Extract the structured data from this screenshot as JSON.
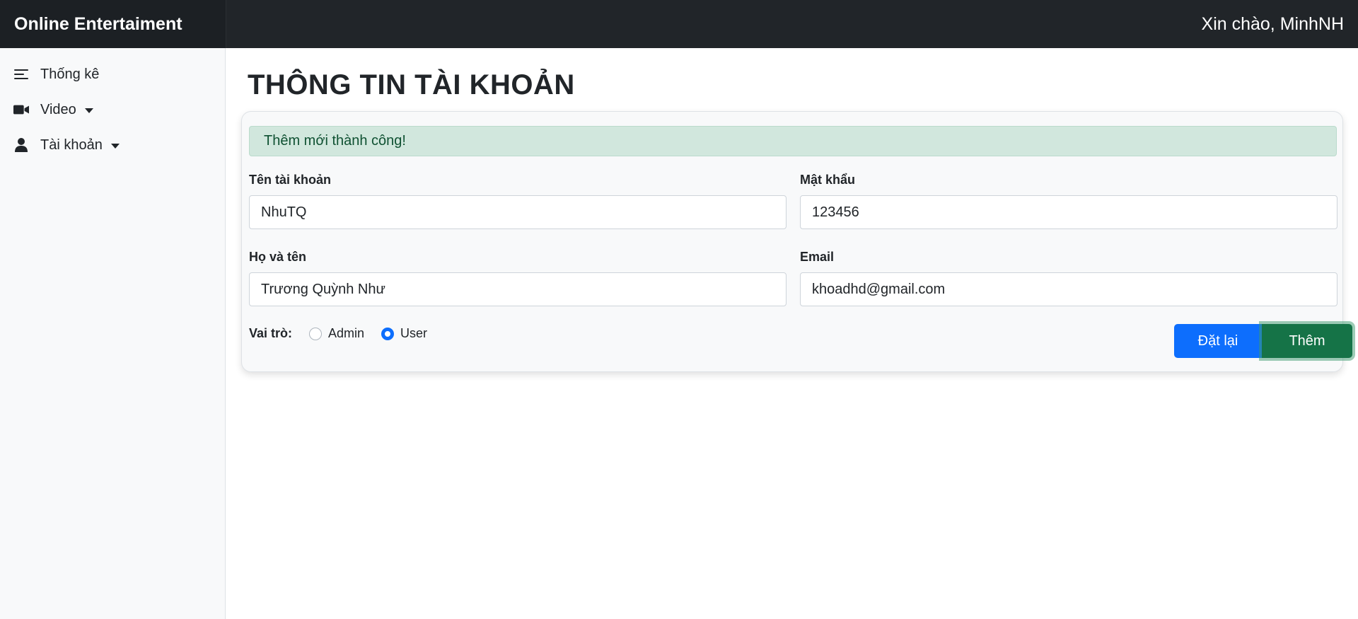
{
  "header": {
    "brand": "Online Entertaiment",
    "greeting": "Xin chào, MinhNH"
  },
  "sidebar": {
    "items": [
      {
        "label": "Thống kê",
        "icon": "list-icon",
        "dropdown": false
      },
      {
        "label": "Video",
        "icon": "video-camera-icon",
        "dropdown": true
      },
      {
        "label": "Tài khoản",
        "icon": "user-icon",
        "dropdown": true
      }
    ]
  },
  "main": {
    "title": "THÔNG TIN TÀI KHOẢN",
    "alert": "Thêm mới thành công!",
    "form": {
      "username_label": "Tên tài khoản",
      "username_value": "NhuTQ",
      "password_label": "Mật khẩu",
      "password_value": "123456",
      "fullname_label": "Họ và tên",
      "fullname_value": "Trương Quỳnh Như",
      "email_label": "Email",
      "email_value": "khoadhd@gmail.com",
      "role_label": "Vai trò:",
      "role_options": [
        "Admin",
        "User"
      ],
      "role_selected": "User"
    },
    "buttons": {
      "reset": "Đặt lại",
      "add": "Thêm"
    }
  },
  "colors": {
    "topbar": "#212529",
    "alert_bg": "#d1e7dd",
    "alert_text": "#0f5132",
    "primary": "#0d6efd",
    "success": "#157347"
  }
}
